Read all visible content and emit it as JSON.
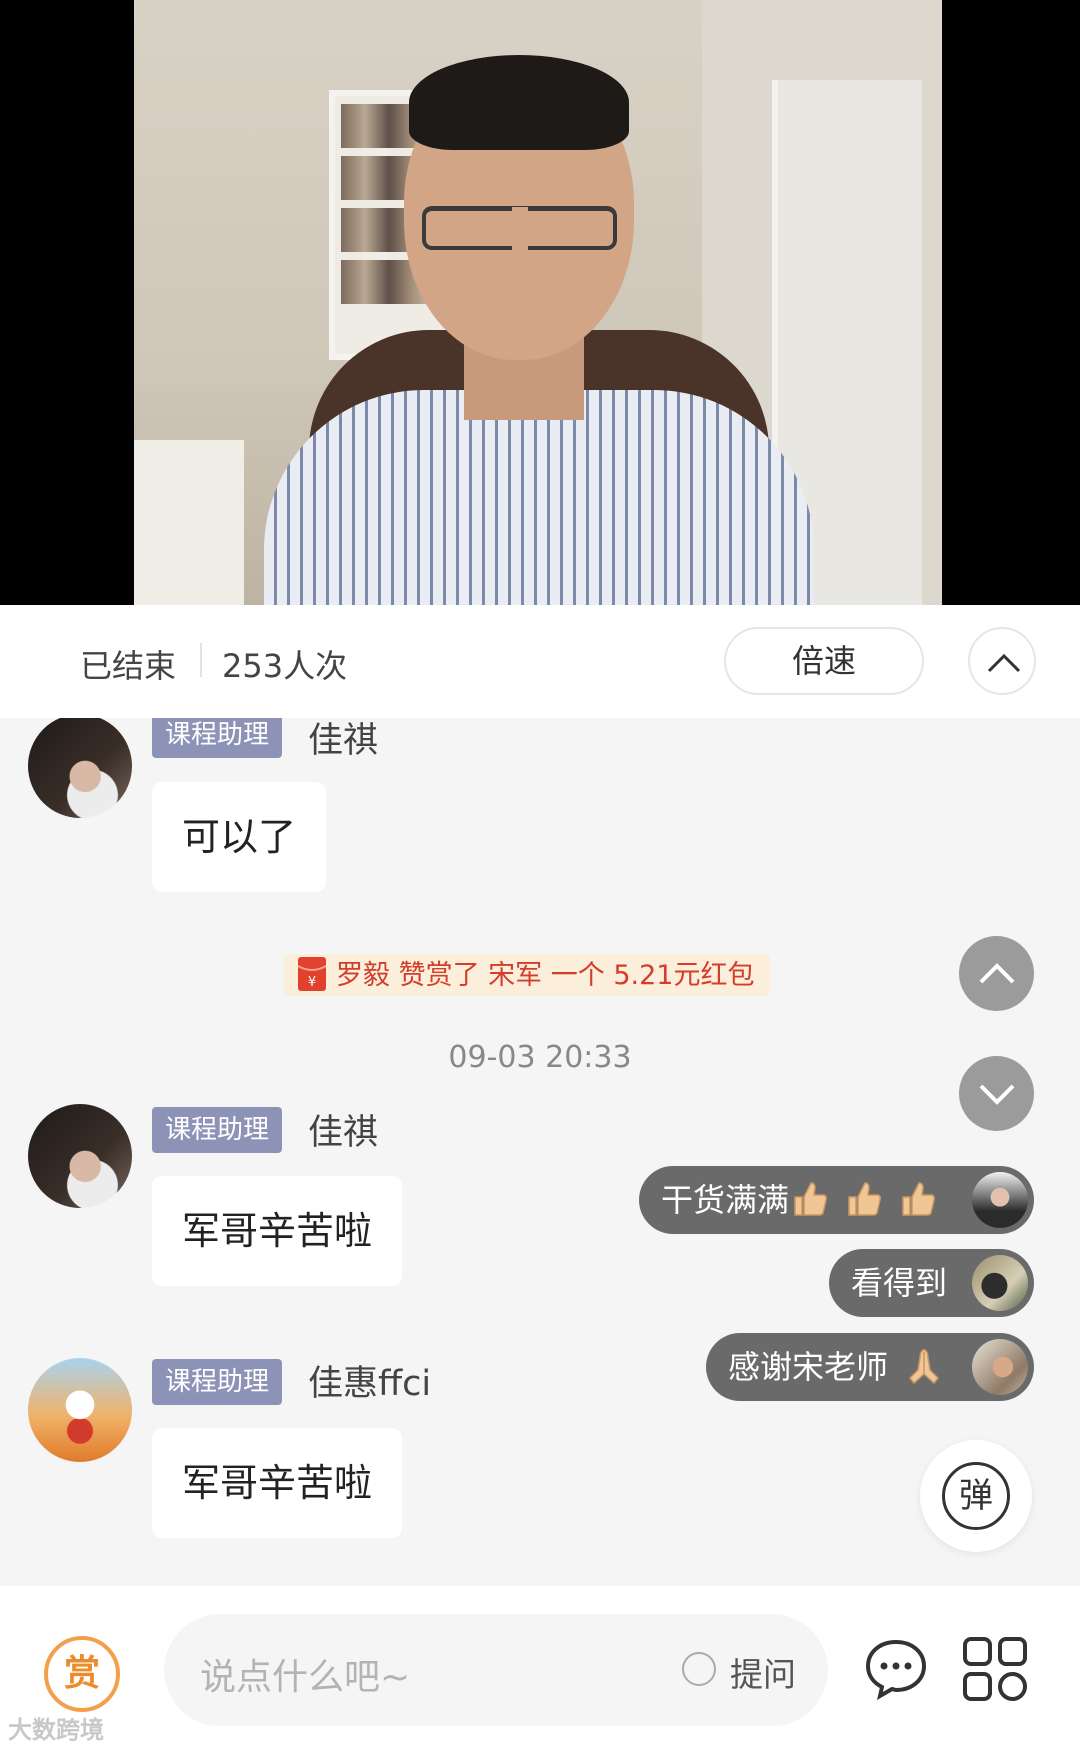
{
  "status": {
    "state": "已结束",
    "viewers": "253人次",
    "speed_label": "倍速"
  },
  "messages": [
    {
      "role": "课程助理",
      "name": "佳祺",
      "text": "可以了"
    },
    {
      "role": "课程助理",
      "name": "佳祺",
      "text": "军哥辛苦啦"
    },
    {
      "role": "课程助理",
      "name": "佳惠ffci",
      "text": "军哥辛苦啦"
    }
  ],
  "notice": {
    "redpacket_text": "罗毅 赞赏了 宋军 一个 5.21元红包"
  },
  "timestamp": "09-03 20:33",
  "danmu": [
    {
      "text": "干货满满"
    },
    {
      "text": "看得到"
    },
    {
      "text": "感谢宋老师"
    }
  ],
  "danmu_toggle": "弹",
  "bottom": {
    "reward_label": "赏",
    "input_placeholder": "说点什么吧~",
    "ask_label": "提问",
    "watermark": "大数跨境"
  },
  "colors": {
    "role_badge": "#8c93b7",
    "redpacket_text": "#d33d2a",
    "reward_accent": "#ec8b2c"
  }
}
